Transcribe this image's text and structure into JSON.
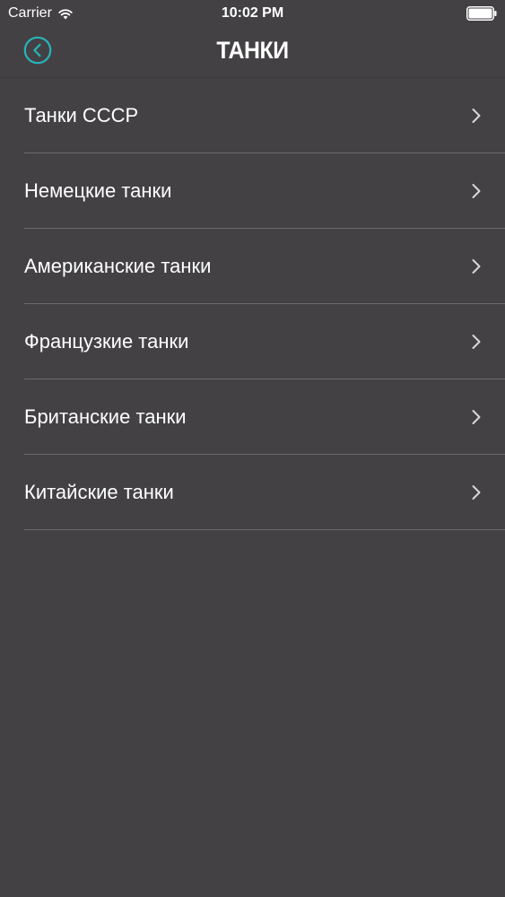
{
  "status_bar": {
    "carrier": "Carrier",
    "time": "10:02 PM",
    "wifi_icon": "wifi-icon",
    "battery_icon": "battery-icon"
  },
  "nav": {
    "title": "ТАНКИ",
    "back_icon": "back-circle-icon",
    "accent_color": "#27b3b8"
  },
  "colors": {
    "background": "#434144",
    "separator": "#6b696c",
    "text": "#ffffff",
    "chevron": "#d8d8d8"
  },
  "list": {
    "items": [
      {
        "label": "Танки СССР"
      },
      {
        "label": "Немецкие танки"
      },
      {
        "label": "Американские танки"
      },
      {
        "label": "Французкие танки"
      },
      {
        "label": "Британские танки"
      },
      {
        "label": "Китайские танки"
      }
    ],
    "row_icon": "chevron-right-icon"
  }
}
